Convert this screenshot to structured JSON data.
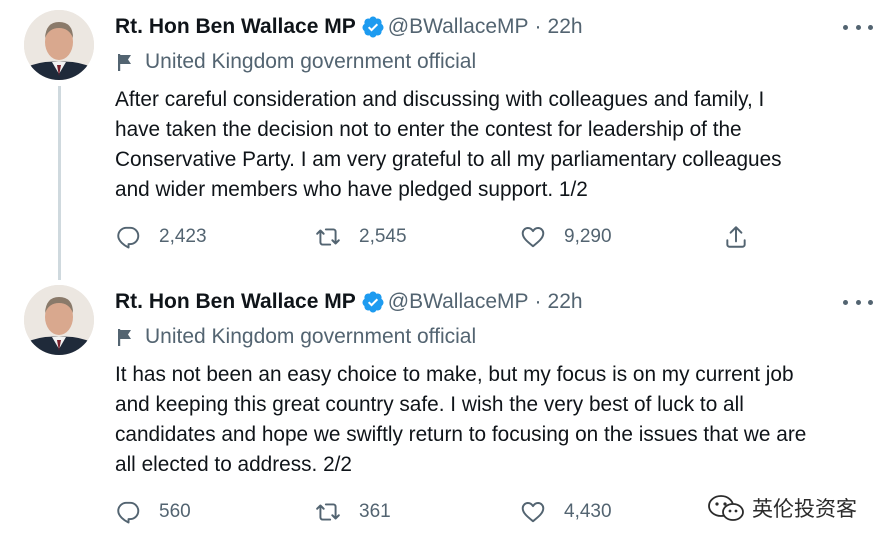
{
  "tweets": [
    {
      "display_name": "Rt. Hon Ben Wallace MP",
      "handle": "@BWallaceMP",
      "separator": "·",
      "time": "22h",
      "label": "United Kingdom government official",
      "text": "After careful consideration and discussing with colleagues and family, I\nhave taken the decision not to enter the contest for leadership of the\nConservative Party.  I am very grateful to all my parliamentary colleagues\nand wider members who have pledged support.  1/2",
      "replies": "2,423",
      "retweets": "2,545",
      "likes": "9,290"
    },
    {
      "display_name": "Rt. Hon Ben Wallace MP",
      "handle": "@BWallaceMP",
      "separator": "·",
      "time": "22h",
      "label": "United Kingdom government official",
      "text": "It has not been an easy choice to make, but my focus is on my current job\nand keeping this great country safe. I wish the very best of luck to all\ncandidates and hope we swiftly return to focusing on the issues that we are\nall elected to address. 2/2",
      "replies": "560",
      "retweets": "361",
      "likes": "4,430"
    }
  ],
  "watermark": "英伦投资客",
  "icons": {
    "verified": "verified-badge-icon",
    "label": "flag-icon",
    "more": "more-options-icon",
    "reply": "reply-icon",
    "retweet": "retweet-icon",
    "like": "heart-icon",
    "share": "share-icon",
    "watermark": "wechat-icon"
  },
  "colors": {
    "text": "#0f1419",
    "secondary": "#536471",
    "verified": "#1d9bf0",
    "thread_line": "#cfd9de"
  }
}
